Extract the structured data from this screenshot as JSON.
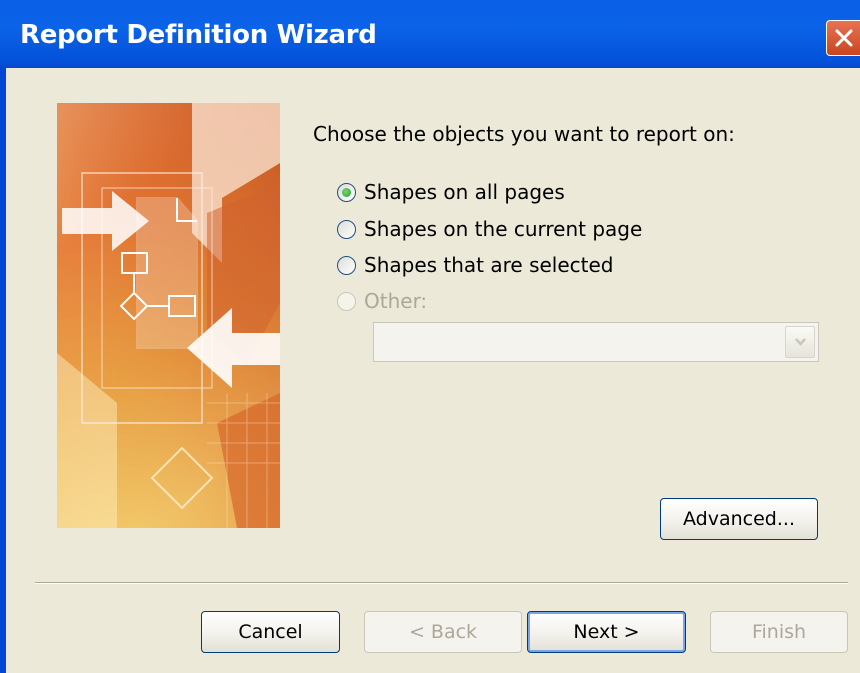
{
  "window": {
    "title": "Report Definition Wizard"
  },
  "prompt": "Choose the objects you want to report on:",
  "options": [
    {
      "label": "Shapes on all pages",
      "checked": true,
      "enabled": true
    },
    {
      "label": "Shapes on the current page",
      "checked": false,
      "enabled": true
    },
    {
      "label": "Shapes that are selected",
      "checked": false,
      "enabled": true
    },
    {
      "label": "Other:",
      "checked": false,
      "enabled": false
    }
  ],
  "other_select": {
    "value": "",
    "enabled": false
  },
  "buttons": {
    "advanced": "Advanced...",
    "cancel": "Cancel",
    "back": "< Back",
    "next": "Next >",
    "finish": "Finish"
  },
  "colors": {
    "titlebar": "#0a5fe6",
    "dialog_bg": "#ece9d8",
    "disabled_text": "#aca899",
    "close": "#d9552f"
  },
  "icons": {
    "close": "close-icon",
    "dropdown": "chevron-down-icon",
    "banner": "report-wizard-banner"
  }
}
